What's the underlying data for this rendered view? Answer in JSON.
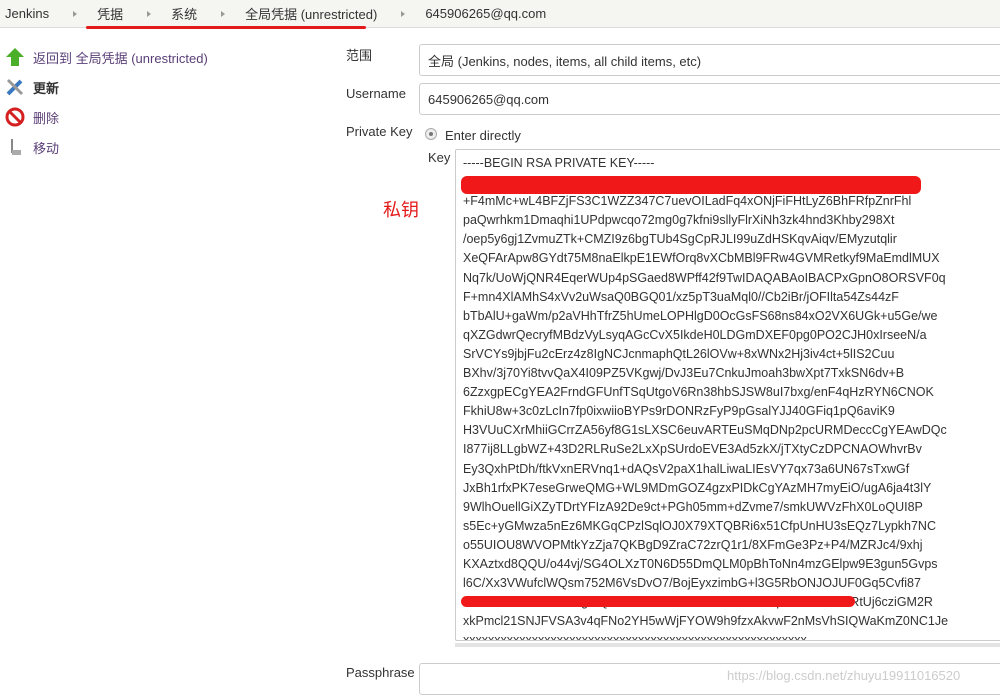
{
  "breadcrumb": [
    "Jenkins",
    "凭据",
    "系统",
    "全局凭据 (unrestricted)",
    "645906265@qq.com"
  ],
  "sidebar": {
    "items": [
      {
        "label": "返回到 全局凭据 (unrestricted)",
        "icon": "up-arrow-icon"
      },
      {
        "label": "更新",
        "icon": "tools-icon"
      },
      {
        "label": "删除",
        "icon": "no-entry-icon"
      },
      {
        "label": "移动",
        "icon": "move-icon"
      }
    ]
  },
  "form": {
    "scope_label": "范围",
    "scope_value": "全局 (Jenkins, nodes, items, all child items, etc)",
    "username_label": "Username",
    "username_value": "645906265@qq.com",
    "private_key_label": "Private Key",
    "enter_directly_label": "Enter directly",
    "key_label": "Key",
    "key_value": "-----BEGIN RSA PRIVATE KEY-----\nMIIEpAIBAAKCAQEAxxxxxxxxxxxxxxxxxxxxxxxxxxxxxxxxxxxxxxxxxxxxxxxR\n+F4mMc+wL4BFZjFS3C1WZZ347C7uevOILadFq4xONjFiFHtLyZ6BhFRfpZnrFhl\npaQwrhkm1Dmaqhi1UPdpwcqo72mg0g7kfni9sllyFlrXiNh3zk4hnd3Khby298Xt\n/oep5y6gj1ZvmuZTk+CMZI9z6bgTUb4SgCpRJLI99uZdHSKqvAiqv/EMyzutqlir\nXeQFArApw8GYdt75M8naElkpE1EWfOrq8vXCbMBl9FRw4GVMRetkyf9MaEmdlMUX\nNq7k/UoWjQNR4EqerWUp4pSGaed8WPff42f9TwIDAQABAoIBACPxGpnO8ORSVF0q\nF+mn4XlAMhS4xVv2uWsaQ0BGQ01/xz5pT3uaMql0//Cb2iBr/jOFIlta54Zs44zF\nbTbAlU+gaWm/p2aVHhTfrZ5hUmeLOPHlgD0OcGsFS68ns84xO2VX6UGk+u5Ge/we\nqXZGdwrQecryfMBdzVyLsyqAGcCvX5IkdeH0LDGmDXEF0pg0PO2CJH0xIrseeN/a\nSrVCYs9jbjFu2cErz4z8IgNCJcnmaphQtL26lOVw+8xWNx2Hj3iv4ct+5lIS2Cuu\nBXhv/3j70Yi8tvvQaX4I09PZ5VKgwj/DvJ3Eu7CnkuJmoah3bwXpt7TxkSN6dv+B\n6ZzxgpECgYEA2FrndGFUnfTSqUtgoV6Rn38hbSJSW8uI7bxg/enF4qHzRYN6CNOK\nFkhiU8w+3c0zLcIn7fp0ixwiioBYPs9rDONRzFyP9pGsalYJJ40GFiq1pQ6aviK9\nH3VUuCXrMhiiGCrrZA56yf8G1sLXSC6euvARTEuSMqDNp2pcURMDeccCgYEAwDQc\nI877ij8LLgbWZ+43D2RLRuSe2LxXpSUrdoEVE3Ad5zkX/jTXtyCzDPCNAOWhvrBv\nEy3QxhPtDh/ftkVxnERVnq1+dAQsV2paX1halLiwaLIEsVY7qx73a6UN67sTxwGf\nJxBh1rfxPK7eseGrweQMG+WL9MDmGOZ4gzxPIDkCgYAzMH7myEiO/ugA6ja4t3lY\n9WlhOuellGiXZyTDrtYFIzA92De9ct+PGh05mm+dZvme7/smkUWVzFhX0LoQUI8P\ns5Ec+yGMwza5nEz6MKGqCPzlSqlOJ0X79XTQBRi6x51CfpUnHU3sEQz7Lypkh7NC\no55UIOU8WVOPMtkYzZja7QKBgD9ZraC72zrQ1r1/8XFmGe3Pz+P4/MZRJc4/9xhj\nKXAztxd8QQU/o44vj/SG4OLXzT0N6D55DmQLM0pBhToNn4mzGElpw9E3gun5Gvps\nl6C/Xx3VWufclWQsm752M6VsDvO7/BojEyxzimbG+l3G5RbONJOJUF0Gq5Cvfi87\nVJU5AoGAAUSti4DkgMQze1fU1wwYxKSnc2HOxA46Fq3i4+DLJmkERtUj6cziGM2R\nxkPmcl21SNJFVSA3v4qFNo2YH5wWjFYOW9h9fzxAkvwF2nMsVhSIQWaKmZ0NC1Je\nxxxxxxxxxxxxxxxxxxxxxxxxxxxxxxxxxxxxxxxxxxxxxxxxxxxxxxx\n-----END RSA PRIVATE KEY-----",
    "passphrase_label": "Passphrase",
    "passphrase_value": ""
  },
  "annotation": {
    "label": "私钥",
    "color": "#e41b1b"
  },
  "watermark": "https://blog.csdn.net/zhuyu19911016520"
}
